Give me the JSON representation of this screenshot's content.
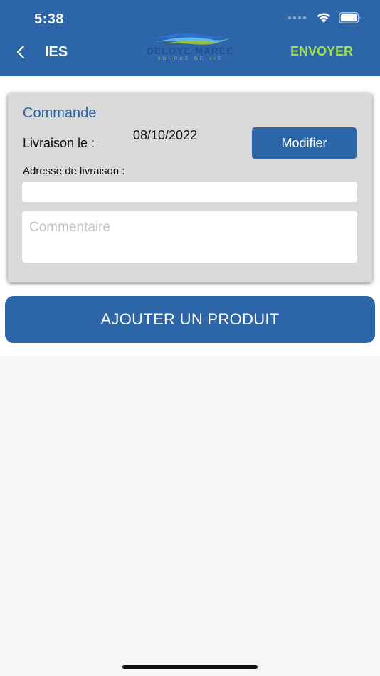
{
  "status_bar": {
    "time": "5:38"
  },
  "header": {
    "back_label": "IES",
    "logo_text": "DELOYE MARÉE",
    "logo_subtext": "SOURCE DE VIE",
    "send_label": "ENVOYER"
  },
  "order": {
    "title": "Commande",
    "delivery_label": "Livraison le :",
    "delivery_date": "08/10/2022",
    "modify_label": "Modifier",
    "address_label": "Adresse de livraison :",
    "address_value": "",
    "comment_placeholder": "Commentaire"
  },
  "add_product_label": "AJOUTER UN PRODUIT",
  "colors": {
    "primary": "#2d66a8",
    "accent_green": "#9fe04d",
    "card_bg": "#d9d9d9"
  }
}
